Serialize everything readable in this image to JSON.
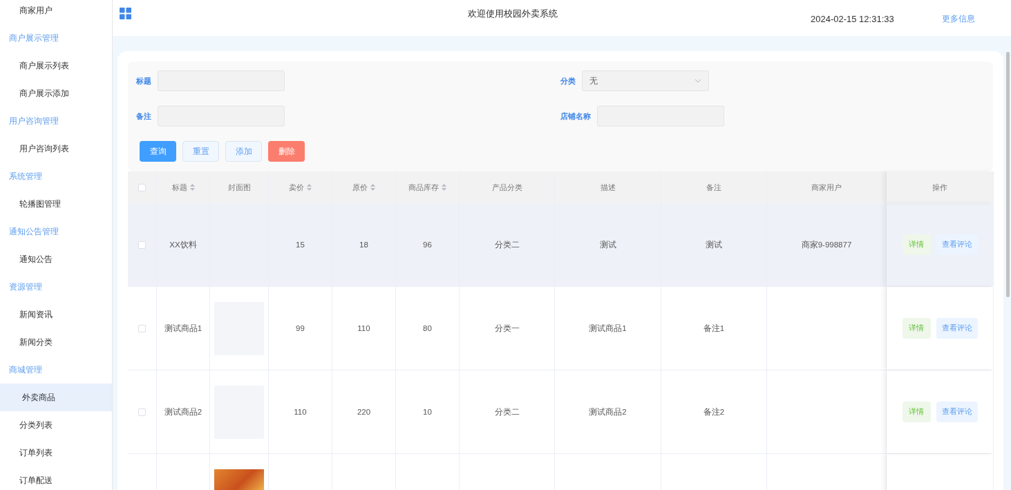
{
  "sidebar": {
    "items": [
      {
        "label": "商家用户",
        "kind": "item",
        "selected": false
      },
      {
        "label": "商户展示管理",
        "kind": "group",
        "selected": false
      },
      {
        "label": "商户展示列表",
        "kind": "item",
        "selected": false
      },
      {
        "label": "商户展示添加",
        "kind": "item",
        "selected": false
      },
      {
        "label": "用户咨询管理",
        "kind": "group",
        "selected": false
      },
      {
        "label": "用户咨询列表",
        "kind": "item",
        "selected": false
      },
      {
        "label": "系统管理",
        "kind": "group",
        "selected": false
      },
      {
        "label": "轮播图管理",
        "kind": "item",
        "selected": false
      },
      {
        "label": "通知公告管理",
        "kind": "group",
        "selected": false
      },
      {
        "label": "通知公告",
        "kind": "item",
        "selected": false
      },
      {
        "label": "资源管理",
        "kind": "group",
        "selected": false
      },
      {
        "label": "新闻资讯",
        "kind": "item",
        "selected": false
      },
      {
        "label": "新闻分类",
        "kind": "item",
        "selected": false
      },
      {
        "label": "商城管理",
        "kind": "group",
        "selected": false
      },
      {
        "label": "外卖商品",
        "kind": "item",
        "selected": true
      },
      {
        "label": "分类列表",
        "kind": "item",
        "selected": false
      },
      {
        "label": "订单列表",
        "kind": "item",
        "selected": false
      },
      {
        "label": "订单配送",
        "kind": "item",
        "selected": false
      }
    ]
  },
  "header": {
    "title": "欢迎使用校园外卖系统",
    "datetime": "2024-02-15 12:31:33",
    "link": "更多信息"
  },
  "search_form": {
    "fields": [
      {
        "label": "标题",
        "kind": "text"
      },
      {
        "label": "分类",
        "kind": "select",
        "value": "无"
      },
      {
        "label": "备注",
        "kind": "text"
      },
      {
        "label": "店铺名称",
        "kind": "text"
      }
    ],
    "buttons": [
      {
        "label": "查询",
        "kind": "primary"
      },
      {
        "label": "重置",
        "kind": "plain"
      },
      {
        "label": "添加",
        "kind": "plain"
      },
      {
        "label": "删除",
        "kind": "danger"
      }
    ]
  },
  "table": {
    "select_all_checked": false,
    "columns": [
      {
        "label": "标题",
        "sortable": true
      },
      {
        "label": "封面图",
        "sortable": false
      },
      {
        "label": "卖价",
        "sortable": true
      },
      {
        "label": "原价",
        "sortable": true
      },
      {
        "label": "商品库存",
        "sortable": true
      },
      {
        "label": "产品分类",
        "sortable": false
      },
      {
        "label": "描述",
        "sortable": false
      },
      {
        "label": "备注",
        "sortable": false
      },
      {
        "label": "商家用户",
        "sortable": false
      },
      {
        "label": "操作",
        "sortable": false
      }
    ],
    "rows": [
      {
        "checked": false,
        "hovered": true,
        "cells": [
          "XX饮料",
          null,
          "15",
          "18",
          "96",
          "分类二",
          "测试",
          "测试",
          "商家9-998877"
        ],
        "actions": [
          "详情",
          "查看评论"
        ]
      },
      {
        "checked": false,
        "hovered": false,
        "cells": [
          "测试商品1",
          {
            "kind": "blank"
          },
          "99",
          "110",
          "80",
          "分类一",
          "测试商品1",
          "备注1",
          null
        ],
        "actions": [
          "详情",
          "查看评论"
        ]
      },
      {
        "checked": false,
        "hovered": false,
        "cells": [
          "测试商品2",
          {
            "kind": "blank"
          },
          "110",
          "220",
          "10",
          "分类二",
          "测试商品2",
          "备注2",
          null
        ],
        "actions": [
          "详情",
          "查看评论"
        ]
      },
      {
        "hovered": false,
        "cells": [
          null,
          {
            "kind": "photo"
          },
          null,
          null,
          null,
          null,
          null,
          null,
          null
        ],
        "actions": []
      }
    ]
  }
}
